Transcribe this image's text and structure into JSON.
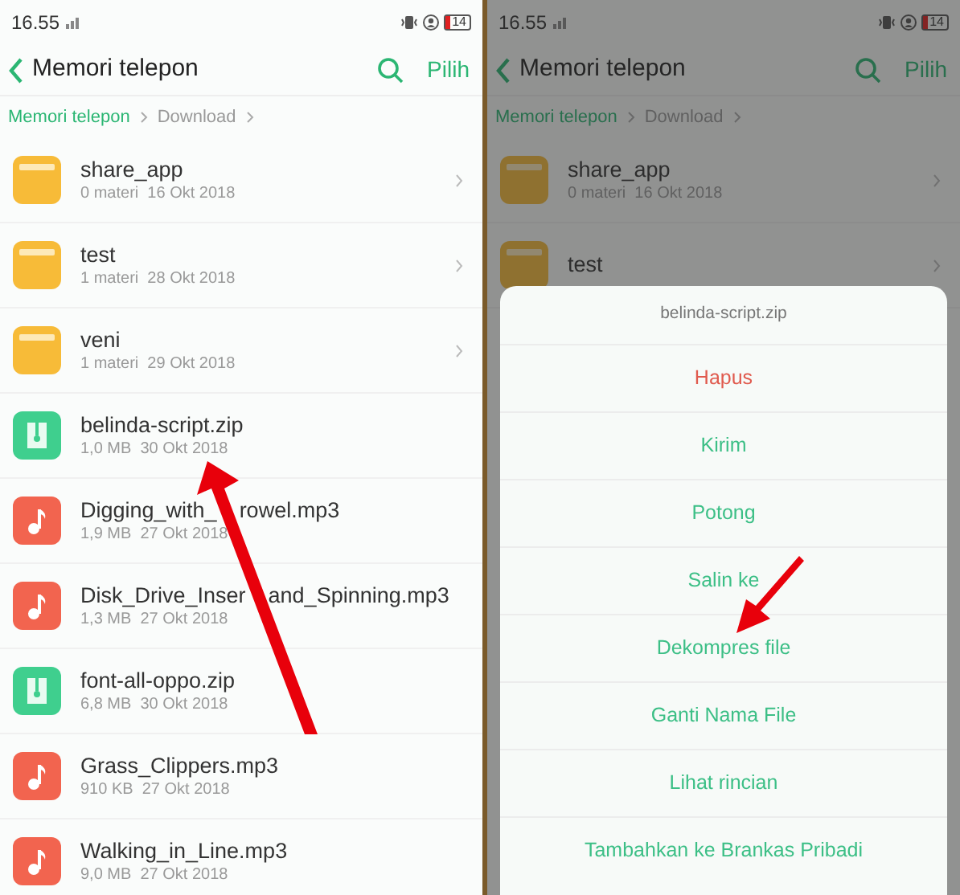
{
  "panels": [
    {
      "status_bar": {
        "time": "16.55",
        "battery": "14"
      },
      "header": {
        "title": "Memori telepon",
        "action": "Pilih"
      },
      "breadcrumb": [
        {
          "label": "Memori telepon",
          "selected": false
        },
        {
          "label": "Download",
          "selected": true
        }
      ],
      "files": [
        {
          "kind": "folder",
          "name_parts": [
            "share_app"
          ],
          "meta": "0 materi  16 Okt 2018"
        },
        {
          "kind": "folder",
          "name_parts": [
            "test"
          ],
          "meta": "1 materi  28 Okt 2018"
        },
        {
          "kind": "folder",
          "name_parts": [
            "veni"
          ],
          "meta": "1 materi  29 Okt 2018"
        },
        {
          "kind": "zip",
          "name_parts": [
            "belinda-script.zip"
          ],
          "meta": "1,0 MB  30 Okt 2018"
        },
        {
          "kind": "audio",
          "name_parts": [
            "Digging_with_",
            "rowel.mp3"
          ],
          "meta": "1,9 MB  27 Okt 2018"
        },
        {
          "kind": "audio",
          "name_parts": [
            "Disk_Drive_Inser",
            "and_Spinning.mp3"
          ],
          "meta": "1,3 MB  27 Okt 2018"
        },
        {
          "kind": "zip",
          "name_parts": [
            "font-all-oppo.zip"
          ],
          "meta": "6,8 MB  30 Okt 2018"
        },
        {
          "kind": "audio",
          "name_parts": [
            "Grass_Clippers.mp3"
          ],
          "meta": "910 KB  27 Okt 2018"
        },
        {
          "kind": "audio",
          "name_parts": [
            "Walking_in_Line.mp3"
          ],
          "meta": "9,0 MB  27 Okt 2018"
        }
      ]
    },
    {
      "status_bar": {
        "time": "16.55",
        "battery": "14"
      },
      "header": {
        "title": "Memori telepon",
        "action": "Pilih"
      },
      "breadcrumb": [
        {
          "label": "Memori telepon",
          "selected": false
        },
        {
          "label": "Download",
          "selected": true
        }
      ],
      "files": [
        {
          "kind": "folder",
          "name_parts": [
            "share_app"
          ],
          "meta": "0 materi  16 Okt 2018"
        },
        {
          "kind": "folder",
          "name_parts": [
            "test"
          ]
        }
      ],
      "sheet": {
        "title": "belinda-script.zip",
        "actions": [
          {
            "label": "Hapus",
            "kind": "danger"
          },
          {
            "label": "Kirim",
            "kind": "normal"
          },
          {
            "label": "Potong",
            "kind": "normal"
          },
          {
            "label": "Salin ke",
            "kind": "normal"
          },
          {
            "label": "Dekompres file",
            "kind": "normal"
          },
          {
            "label": "Ganti Nama File",
            "kind": "normal"
          },
          {
            "label": "Lihat rincian",
            "kind": "normal"
          },
          {
            "label": "Tambahkan ke Brankas Pribadi",
            "kind": "normal"
          }
        ]
      }
    }
  ]
}
